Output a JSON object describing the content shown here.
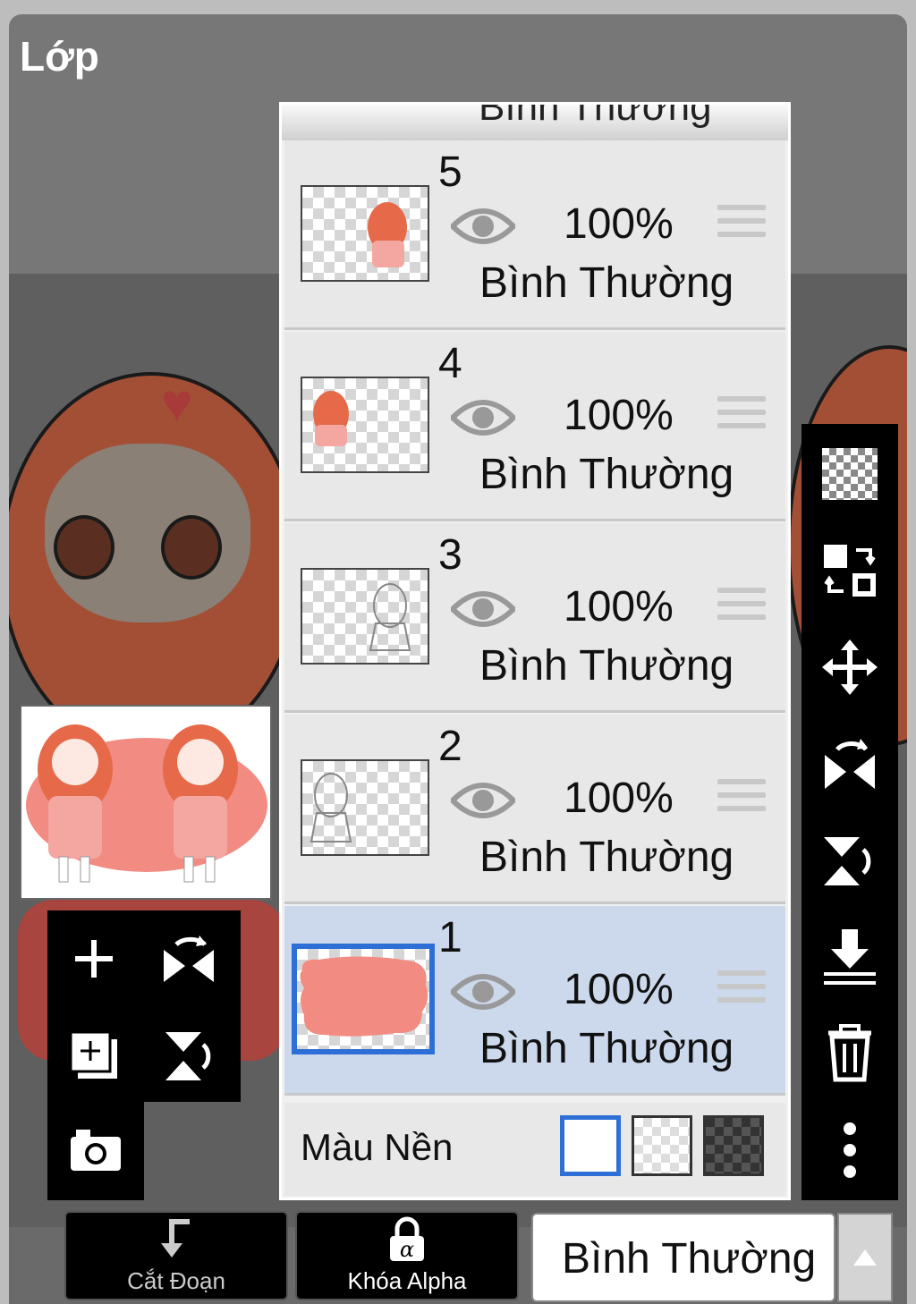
{
  "title": "Lớp",
  "layer_panel": {
    "partial_top_blend": "Bình Thường",
    "layers": [
      {
        "number": "5",
        "opacity": "100%",
        "blend": "Bình Thường",
        "selected": false
      },
      {
        "number": "4",
        "opacity": "100%",
        "blend": "Bình Thường",
        "selected": false
      },
      {
        "number": "3",
        "opacity": "100%",
        "blend": "Bình Thường",
        "selected": false
      },
      {
        "number": "2",
        "opacity": "100%",
        "blend": "Bình Thường",
        "selected": false
      },
      {
        "number": "1",
        "opacity": "100%",
        "blend": "Bình Thường",
        "selected": true
      }
    ],
    "background_label": "Màu Nền",
    "background_swatches": [
      "white",
      "transparent",
      "dark-checker"
    ]
  },
  "right_toolbar": {
    "icons": [
      "checker-icon",
      "swap-layer-icon",
      "move-icon",
      "flip-horizontal-icon",
      "flip-vertical-icon",
      "merge-down-icon",
      "trash-icon",
      "more-icon"
    ]
  },
  "left_toolbar": {
    "icons": [
      "add-layer-icon",
      "flip-h-icon",
      "add-copy-layer-icon",
      "flip-v-icon",
      "camera-icon"
    ]
  },
  "bottom": {
    "clip_label": "Cắt Đoạn",
    "alpha_lock_label": "Khóa Alpha",
    "blend_mode": "Bình Thường"
  },
  "colors": {
    "selected_layer_bg": "#ccd8ec",
    "selected_border": "#2d6fd6",
    "salmon": "#f28b82"
  }
}
